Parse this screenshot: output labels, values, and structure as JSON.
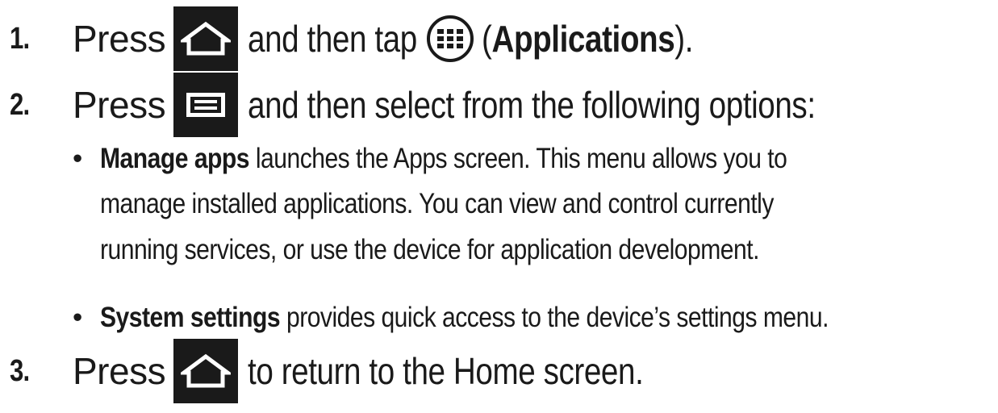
{
  "steps": [
    {
      "number": "1.",
      "press": "Press",
      "then": "and then tap",
      "paren_open": "(",
      "app_label": "Applications",
      "paren_close": ").",
      "home_key_icon": "home-icon",
      "apps_icon": "apps-grid-icon"
    },
    {
      "number": "2.",
      "press": "Press",
      "then": "and then select from the following options:",
      "menu_key_icon": "menu-icon",
      "options": [
        {
          "name": "Manage apps",
          "lines": [
            "launches the Apps screen. This menu allows you to",
            "manage installed applications. You can view and control currently",
            "running services, or use the device for application development."
          ]
        },
        {
          "name": "System settings",
          "lines": [
            "provides quick access to the device’s settings menu."
          ]
        }
      ]
    },
    {
      "number": "3.",
      "press": "Press",
      "then": "to return to the Home screen.",
      "home_key_icon": "home-icon"
    }
  ],
  "bullet_char": "•",
  "colors": {
    "text": "#1a1a1a",
    "key_background": "#1a1a1a",
    "key_icon": "#ffffff"
  }
}
